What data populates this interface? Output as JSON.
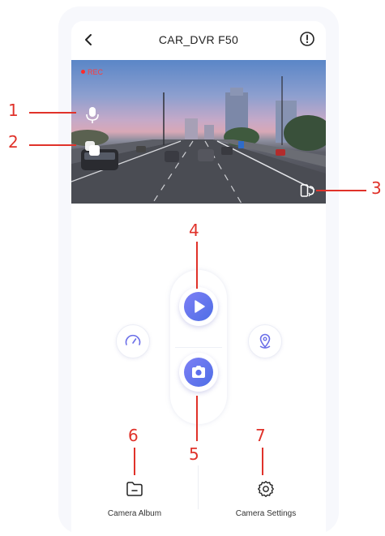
{
  "header": {
    "title": "CAR_DVR F50"
  },
  "video": {
    "rec_label": "REC"
  },
  "bottom_nav": [
    {
      "label": "Camera Album",
      "icon": "folder-icon"
    },
    {
      "label": "Camera Settings",
      "icon": "gear-icon"
    }
  ],
  "callouts": [
    "1",
    "2",
    "3",
    "4",
    "5",
    "6",
    "7"
  ],
  "colors": {
    "accent": "#5b6ef0",
    "callout": "#e0322a"
  }
}
